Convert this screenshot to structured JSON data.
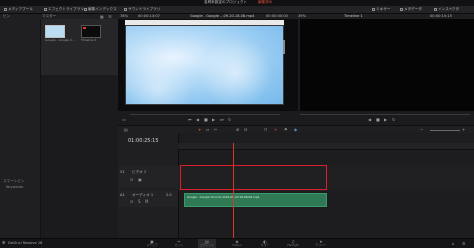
{
  "window": {
    "title": "名称未設定のプロジェクト",
    "status": "編集済み"
  },
  "toolbar": {
    "media_pool": "メディアプール",
    "effects": "エフェクトライブラリ",
    "edit_index": "編集インデックス",
    "sound_library": "サウンドライブラリ",
    "mixer": "ミキサー",
    "metadata": "メタデータ",
    "inspector": "インスペクタ"
  },
  "media_pool": {
    "breadcrumb": "マスター",
    "bin_label": "ビン",
    "clips": [
      {
        "name": "Google - Google 2...",
        "thumb_color": "#bcdcf2"
      },
      {
        "name": "Timeline 1",
        "thumb_color": "#0b0b0b"
      }
    ],
    "smart_bins_label": "スマートビン",
    "keywords_label": "Keywords"
  },
  "viewer": {
    "zoom": "78%",
    "source_timecode": "00:00:13:07",
    "clip_name": "Google - Google ...09.20.18.08.mp4",
    "clip_timecode": "00:00:00:00",
    "timeline_zoom": "39%",
    "timeline_name": "Timeline 1",
    "timeline_timecode": "00:00:15:15"
  },
  "timeline": {
    "timecode": "01:00:25:15",
    "video_track": {
      "label": "ビデオ 1",
      "id": "V1"
    },
    "audio_track": {
      "label": "オーディオ 1",
      "id": "A1",
      "meter": "2.0"
    },
    "audio_clip_name": "Google - Google Chrome 2024-09-20 18-08-08.mp4"
  },
  "bottom": {
    "app_name": "DaVinci Resolve 18",
    "pages": [
      {
        "label": "メディア",
        "glyph": "▣",
        "active": false
      },
      {
        "label": "カット",
        "glyph": "✂",
        "active": false
      },
      {
        "label": "エディット",
        "glyph": "▤",
        "active": true
      },
      {
        "label": "Fusion",
        "glyph": "◈",
        "active": false
      },
      {
        "label": "カラー",
        "glyph": "◐",
        "active": false
      },
      {
        "label": "Fairlight",
        "glyph": "♫",
        "active": false
      },
      {
        "label": "デリバー",
        "glyph": "➤",
        "active": false
      }
    ]
  },
  "colors": {
    "accent_red": "#d9202a",
    "playhead": "#d33a2a",
    "audio_clip": "#2f7a55",
    "panel": "#1f1f22"
  }
}
